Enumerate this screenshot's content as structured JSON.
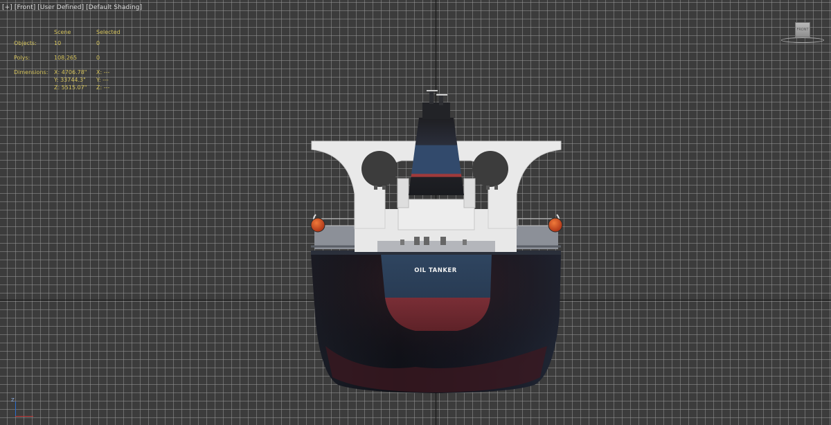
{
  "viewport": {
    "label_plus": "[+]",
    "label_view": "[Front]",
    "label_user": "[User Defined]",
    "label_shading": "[Default Shading]"
  },
  "stats": {
    "header_scene": "Scene",
    "header_selected": "Selected",
    "objects_label": "Objects:",
    "objects_scene": "10",
    "objects_selected": "0",
    "polys_label": "Polys:",
    "polys_scene": "108,265",
    "polys_selected": "0",
    "dimensions_label": "Dimensions:",
    "dim_x": "X: 4706.78\"",
    "dim_y": "Y: 33744.3\"",
    "dim_z": "Z: 5515.07\"",
    "sel_x": "X: ---",
    "sel_y": "Y: ---",
    "sel_z": "Z: ---"
  },
  "viewcube": {
    "face_label": "FRONT"
  },
  "ship": {
    "name": "OIL TANKER"
  },
  "tripod": {
    "axis_label": "Z"
  },
  "colors": {
    "grid_background": "#3c3c3c",
    "stats_text": "#d4c25a",
    "hull_navy": "#1f2b3b",
    "hull_red": "#6b2a30",
    "superstructure": "#ececec"
  }
}
